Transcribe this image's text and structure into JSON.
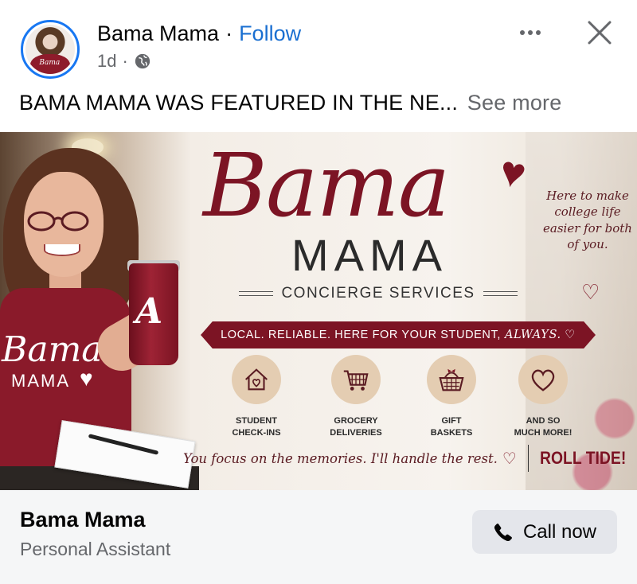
{
  "post": {
    "page_name": "Bama Mama",
    "separator": "·",
    "follow_label": "Follow",
    "time": "1d",
    "time_separator": "·",
    "privacy_icon": "globe-icon",
    "more_icon": "more-options-icon",
    "close_icon": "close-icon",
    "caption": "BAMA MAMA WAS FEATURED IN THE NE...",
    "see_more_label": "See more"
  },
  "avatar": {
    "shirt_text": "Bama"
  },
  "ad": {
    "shirt_script": "Bama",
    "shirt_mama": "MAMA",
    "tumbler_letter": "A",
    "logo_script": "Bama",
    "logo_mama": "MAMA",
    "subtitle": "CONCIERGE SERVICES",
    "tagline": "Here to make college life easier for both of you.",
    "banner_text": "LOCAL. RELIABLE. HERE FOR YOUR STUDENT,",
    "banner_always": "ALWAYS.",
    "services": [
      {
        "label_1": "STUDENT",
        "label_2": "CHECK-INS",
        "icon": "house-heart-icon"
      },
      {
        "label_1": "GROCERY",
        "label_2": "DELIVERIES",
        "icon": "shopping-cart-icon"
      },
      {
        "label_1": "GIFT",
        "label_2": "BASKETS",
        "icon": "gift-basket-icon"
      },
      {
        "label_1": "AND SO",
        "label_2": "MUCH MORE!",
        "icon": "heart-icon"
      }
    ],
    "footer_script": "You focus on the memories. I'll handle the rest.",
    "footer_cta": "ROLL TIDE!"
  },
  "cta": {
    "name": "Bama Mama",
    "category": "Personal Assistant",
    "button_label": "Call now",
    "button_icon": "phone-icon"
  },
  "colors": {
    "follow_blue": "#1a6fd1",
    "brand_crimson": "#7c1424",
    "muted_text": "#65676b",
    "cta_bg": "#f5f6f7",
    "button_bg": "#e4e6eb"
  }
}
